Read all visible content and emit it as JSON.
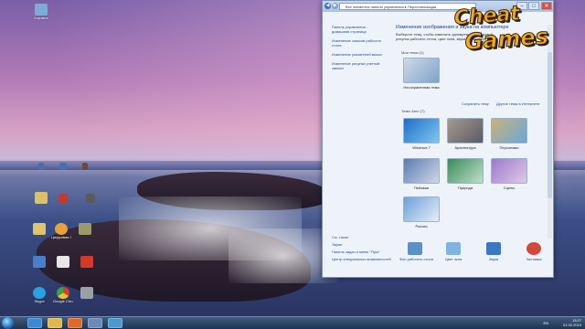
{
  "desktop": {
    "icons": [
      {
        "label": "Корзина",
        "icon": "recycle-bin-icon",
        "color": "#7fa9d8"
      },
      {
        "label": "",
        "icon": "app-icon",
        "color": "#4a6ea8"
      },
      {
        "label": "",
        "icon": "app-icon",
        "color": "#6a4a3a"
      },
      {
        "label": "",
        "icon": "folder-icon",
        "color": "#d9c06a"
      },
      {
        "label": "",
        "icon": "media-icon",
        "color": "#c23a2e"
      },
      {
        "label": "",
        "icon": "app-icon",
        "color": "#5a5a5a"
      },
      {
        "label": "",
        "icon": "folder-icon",
        "color": "#e0c36a"
      },
      {
        "label": "Цифровая Лаборатория",
        "icon": "app-icon",
        "color": "#e7a23a"
      },
      {
        "label": "",
        "icon": "folder-icon",
        "color": "#9a9a6a"
      },
      {
        "label": "",
        "icon": "monitor-icon",
        "color": "#4a7fc7"
      },
      {
        "label": "",
        "icon": "document-icon",
        "color": "#e6e6e6"
      },
      {
        "label": "",
        "icon": "app-icon",
        "color": "#d43a2a"
      },
      {
        "label": "Skype",
        "icon": "skype-icon",
        "color": "#2aa0e0"
      },
      {
        "label": "Google Chrome",
        "icon": "chrome-icon",
        "color": "#3aa04a"
      },
      {
        "label": "",
        "icon": "app-icon",
        "color": "#9aa0a8"
      }
    ]
  },
  "window": {
    "address": "Все элементы панели управления ▸ Персонализация",
    "back_arrow": "◀",
    "forward_arrow": "▶",
    "minimize": "–",
    "maximize": "□",
    "close": "✕",
    "left_links": [
      "Панель управления - домашняя страница",
      "Изменение значков рабочего стола",
      "Изменение указателей мыши",
      "Изменение рисунка учетной записи"
    ],
    "title": "Изменение изображения и звука на компьютере",
    "description": "Выберите тему, чтобы изменить одновременно фоновый рисунок рабочего стола, цвет окна, звуки и заставку.",
    "my_themes_label": "Мои темы (1)",
    "my_themes": [
      {
        "name": "Несохраненная тема",
        "colors": [
          "#cfd9e8",
          "#7fa3c9"
        ]
      }
    ],
    "save_link": "Сохранить тему",
    "online_link": "Другие темы в Интернете",
    "aero_label": "Темы Aero (7)",
    "aero_themes": [
      {
        "name": "Windows 7",
        "colors": [
          "#1d6fc8",
          "#7fc7f0"
        ]
      },
      {
        "name": "Архитектура",
        "colors": [
          "#a59c8f",
          "#5a5a68"
        ]
      },
      {
        "name": "Персонажи",
        "colors": [
          "#c9b27a",
          "#6aa8d8"
        ]
      },
      {
        "name": "Пейзажи",
        "colors": [
          "#5a7ab0",
          "#d0d8e8"
        ]
      },
      {
        "name": "Природа",
        "colors": [
          "#3a8a5a",
          "#bfe0c8"
        ]
      },
      {
        "name": "Сцены",
        "colors": [
          "#9a7acb",
          "#e0c8ea"
        ]
      },
      {
        "name": "Россия",
        "colors": [
          "#6aa0d8",
          "#e8eef8"
        ]
      }
    ],
    "see_also_label": "См. также",
    "see_also": [
      "Экран",
      "Панель задач и меню \"Пуск\"",
      "Центр специальных возможностей"
    ],
    "bottom": [
      {
        "label": "Фон рабочего стола",
        "icon": "desktop-background-icon",
        "color": "#5a8fc7"
      },
      {
        "label": "Цвет окна",
        "icon": "window-color-icon",
        "color": "#7fb3e0"
      },
      {
        "label": "Звуки",
        "icon": "sounds-icon",
        "color": "#3a78c2"
      },
      {
        "label": "Заставка",
        "icon": "screensaver-icon",
        "color": "#d04a3a"
      }
    ]
  },
  "logo": {
    "line1": "Cheat",
    "line2": "Games"
  },
  "taskbar": {
    "pinned": [
      {
        "icon": "internet-explorer-icon",
        "color": "#3a8ad8"
      },
      {
        "icon": "explorer-folder-icon",
        "color": "#e0b84a"
      },
      {
        "icon": "media-player-icon",
        "color": "#e06a2a"
      },
      {
        "icon": "app-icon",
        "color": "#6a8ab8"
      },
      {
        "icon": "control-panel-icon",
        "color": "#4a9ad0"
      }
    ],
    "language": "EN",
    "time": "13:27",
    "date": "01.02.2013"
  }
}
